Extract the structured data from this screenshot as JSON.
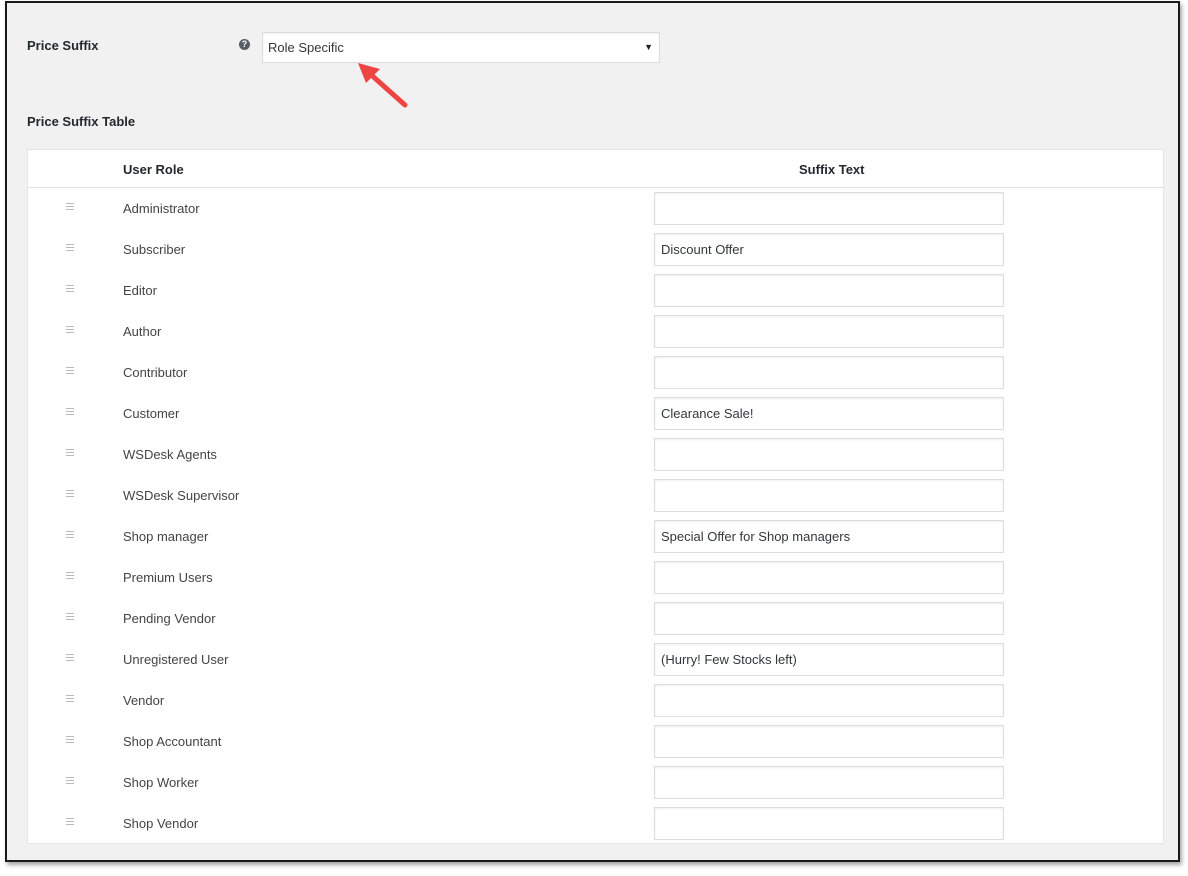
{
  "settings": {
    "price_suffix_label": "Price Suffix",
    "help_icon_glyph": "?",
    "price_suffix_value": "Role Specific",
    "select_arrow_glyph": "▼",
    "table_label": "Price Suffix Table"
  },
  "table": {
    "headers": {
      "user_role": "User Role",
      "suffix_text": "Suffix Text"
    },
    "rows": [
      {
        "role": "Administrator",
        "suffix": ""
      },
      {
        "role": "Subscriber",
        "suffix": "Discount Offer"
      },
      {
        "role": "Editor",
        "suffix": ""
      },
      {
        "role": "Author",
        "suffix": ""
      },
      {
        "role": "Contributor",
        "suffix": ""
      },
      {
        "role": "Customer",
        "suffix": "Clearance Sale!"
      },
      {
        "role": "WSDesk Agents",
        "suffix": ""
      },
      {
        "role": "WSDesk Supervisor",
        "suffix": ""
      },
      {
        "role": "Shop manager",
        "suffix": "Special Offer for Shop managers"
      },
      {
        "role": "Premium Users",
        "suffix": ""
      },
      {
        "role": "Pending Vendor",
        "suffix": ""
      },
      {
        "role": "Unregistered User",
        "suffix": "(Hurry! Few Stocks left)"
      },
      {
        "role": "Vendor",
        "suffix": ""
      },
      {
        "role": "Shop Accountant",
        "suffix": ""
      },
      {
        "role": "Shop Worker",
        "suffix": ""
      },
      {
        "role": "Shop Vendor",
        "suffix": ""
      }
    ]
  },
  "annotation": {
    "arrow_color": "#ee4444"
  }
}
